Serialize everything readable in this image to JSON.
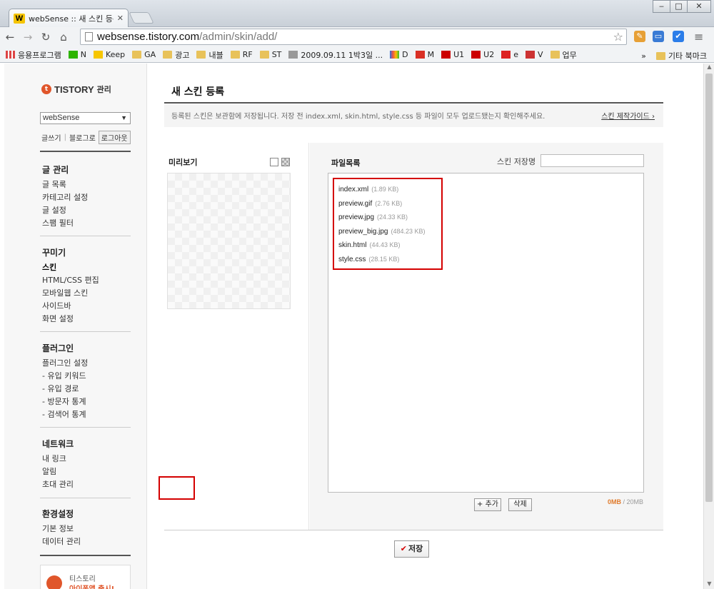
{
  "browser": {
    "tab_title": "webSense :: 새 스킨 등록",
    "tab_favicon": "W",
    "url_host": "websense.tistory.com",
    "url_path": "/admin/skin/add/",
    "bookmarks": [
      {
        "label": "응용프로그램",
        "icon": "apps-icon"
      },
      {
        "label": "N",
        "icon": "naver-icon"
      },
      {
        "label": "Keep",
        "icon": "keep-icon"
      },
      {
        "label": "GA",
        "icon": "folder-icon"
      },
      {
        "label": "광고",
        "icon": "folder-icon"
      },
      {
        "label": "내블",
        "icon": "folder-icon"
      },
      {
        "label": "RF",
        "icon": "folder-icon"
      },
      {
        "label": "ST",
        "icon": "folder-icon"
      },
      {
        "label": "2009.09.11 1박3일 ...",
        "icon": "page-icon"
      },
      {
        "label": "D",
        "icon": "daum-icon"
      },
      {
        "label": "M",
        "icon": "gmail-icon"
      },
      {
        "label": "U1",
        "icon": "youtube-icon"
      },
      {
        "label": "U2",
        "icon": "youtube-icon"
      },
      {
        "label": "e",
        "icon": "e-icon"
      },
      {
        "label": "V",
        "icon": "v-icon"
      },
      {
        "label": "업무",
        "icon": "folder-icon"
      }
    ],
    "other_bookmarks": "기타 북마크",
    "more": "»"
  },
  "sidebar": {
    "logo_text": "TISTORY",
    "logo_sub": "관리",
    "blog_select": "webSense",
    "links": {
      "write": "글쓰기",
      "blog": "블로그로",
      "logout": "로그아웃"
    },
    "groups": [
      {
        "head": "글 관리",
        "items": [
          "글 목록",
          "카테고리 설정",
          "글 설정",
          "스팸 필터"
        ]
      },
      {
        "head": "꾸미기",
        "items": [
          "스킨",
          "HTML/CSS 편집",
          "모바일웹 스킨",
          "사이드바",
          "화면 설정"
        ]
      },
      {
        "head": "플러그인",
        "items": [
          "플러그인 설정",
          "- 유입 키워드",
          "- 유입 경로",
          "- 방문자 통계",
          "- 검색어 통계"
        ]
      },
      {
        "head": "네트워크",
        "items": [
          "내 링크",
          "알림",
          "초대 관리"
        ]
      },
      {
        "head": "환경설정",
        "items": [
          "기본 정보",
          "데이터 관리"
        ]
      }
    ],
    "promo_line1": "티스토리",
    "promo_line2": "아이폰앱 출시!"
  },
  "main": {
    "title": "새 스킨 등록",
    "notice": "등록된 스킨은 보관함에 저장됩니다. 저장 전 index.xml, skin.html, style.css 등 파일이 모두 업로드됐는지 확인해주세요.",
    "guide_link": "스킨 제작가이드 ›",
    "preview_label": "미리보기",
    "files_label": "파일목록",
    "skin_name_label": "스킨 저장명",
    "skin_name_value": "",
    "files": [
      {
        "name": "index.xml",
        "size": "(1.89 KB)"
      },
      {
        "name": "preview.gif",
        "size": "(2.76 KB)"
      },
      {
        "name": "preview.jpg",
        "size": "(24.33 KB)"
      },
      {
        "name": "preview_big.jpg",
        "size": "(484.23 KB)"
      },
      {
        "name": "skin.html",
        "size": "(44.43 KB)"
      },
      {
        "name": "style.css",
        "size": "(28.15 KB)"
      }
    ],
    "add_button": "+ 추가",
    "delete_button": "삭제",
    "quota_used": "0MB",
    "quota_total": " / 20MB",
    "save_button": "저장",
    "highlight_color": "#d40000",
    "accent_color": "#e0562b"
  }
}
